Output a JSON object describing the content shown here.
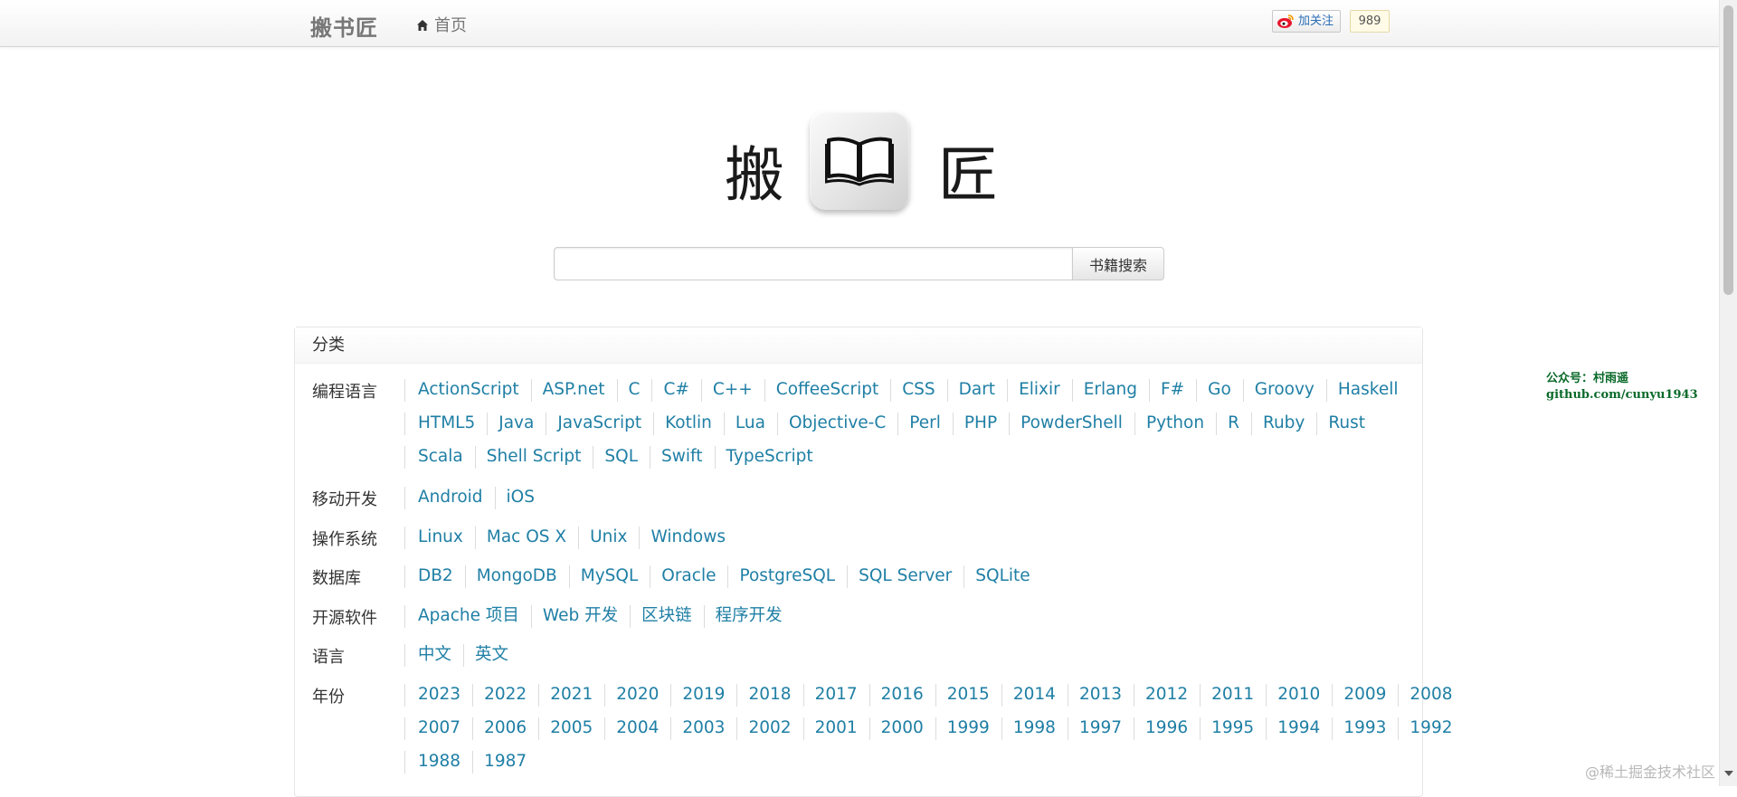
{
  "navbar": {
    "brand": "搬书匠",
    "home_label": "首页",
    "weibo_follow_label": "加关注",
    "weibo_count": "989"
  },
  "logo": {
    "left_char": "搬",
    "right_char": "匠",
    "icon": "open-book-icon"
  },
  "search": {
    "placeholder": "",
    "button_label": "书籍搜索"
  },
  "categories": {
    "title": "分类",
    "rows": [
      {
        "label": "编程语言",
        "lines": [
          [
            "ActionScript",
            "ASP.net",
            "C",
            "C#",
            "C++",
            "CoffeeScript",
            "CSS",
            "Dart",
            "Elixir",
            "Erlang",
            "F#",
            "Go",
            "Groovy",
            "Haskell"
          ],
          [
            "HTML5",
            "Java",
            "JavaScript",
            "Kotlin",
            "Lua",
            "Objective-C",
            "Perl",
            "PHP",
            "PowderShell",
            "Python",
            "R",
            "Ruby",
            "Rust"
          ],
          [
            "Scala",
            "Shell Script",
            "SQL",
            "Swift",
            "TypeScript"
          ]
        ]
      },
      {
        "label": "移动开发",
        "lines": [
          [
            "Android",
            "iOS"
          ]
        ]
      },
      {
        "label": "操作系统",
        "lines": [
          [
            "Linux",
            "Mac OS X",
            "Unix",
            "Windows"
          ]
        ]
      },
      {
        "label": "数据库",
        "lines": [
          [
            "DB2",
            "MongoDB",
            "MySQL",
            "Oracle",
            "PostgreSQL",
            "SQL Server",
            "SQLite"
          ]
        ]
      },
      {
        "label": "开源软件",
        "lines": [
          [
            "Apache 项目",
            "Web 开发",
            "区块链",
            "程序开发"
          ]
        ]
      },
      {
        "label": "语言",
        "lines": [
          [
            "中文",
            "英文"
          ]
        ]
      },
      {
        "label": "年份",
        "lines": [
          [
            "2023",
            "2022",
            "2021",
            "2020",
            "2019",
            "2018",
            "2017",
            "2016",
            "2015",
            "2014",
            "2013",
            "2012",
            "2011",
            "2010",
            "2009",
            "2008"
          ],
          [
            "2007",
            "2006",
            "2005",
            "2004",
            "2003",
            "2002",
            "2001",
            "2000",
            "1999",
            "1998",
            "1997",
            "1996",
            "1995",
            "1994",
            "1993",
            "1992"
          ],
          [
            "1988",
            "1987"
          ]
        ]
      }
    ]
  },
  "watermarks": {
    "side_line1": "公众号：村雨遥",
    "side_line2": "github.com/cunyu1943",
    "corner": "@稀土掘金技术社区"
  },
  "colors": {
    "link": "#1f7fa5",
    "watermark_green": "#0a6a2a"
  }
}
